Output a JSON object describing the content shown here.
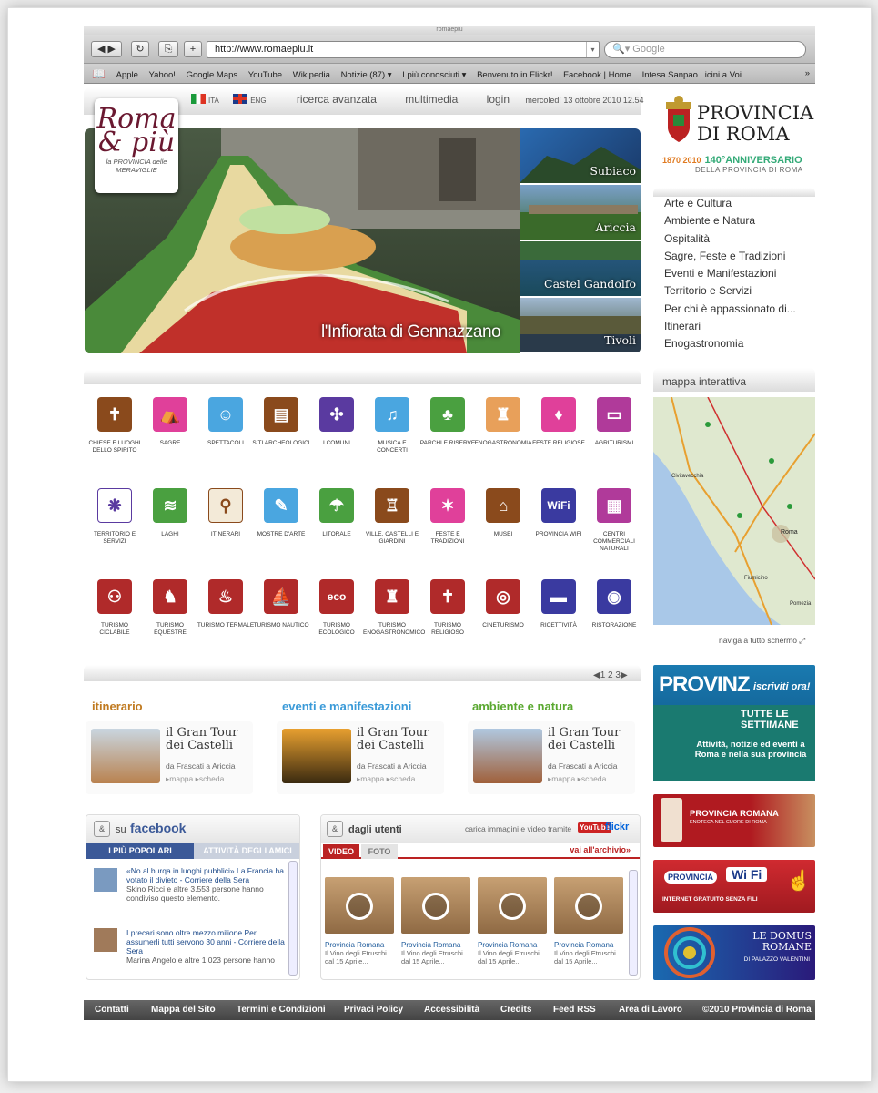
{
  "browser": {
    "window_title": "romaepiu",
    "url": "http://www.romaepiu.it",
    "search_placeholder": "Google",
    "bookmarks": [
      "Apple",
      "Yahoo!",
      "Google Maps",
      "YouTube",
      "Wikipedia",
      "Notizie (87) ▾",
      "I più conosciuti ▾",
      "Benvenuto in Flickr!",
      "Facebook | Home",
      "Intesa Sanpao...icini a Voi."
    ],
    "more": "»"
  },
  "header": {
    "lang_ita": "ITA",
    "lang_eng": "ENG",
    "nav": [
      "ricerca avanzata",
      "multimedia",
      "login"
    ],
    "date": "mercoledì 13 ottobre 2010 12.54"
  },
  "logo": {
    "title": "Roma & più",
    "subtitle": "la PROVINCIA delle MERAVIGLIE"
  },
  "hero": {
    "caption": "l'Infiorata di Gennazzano",
    "thumbs": [
      "Subiaco",
      "Ariccia",
      "Castel Gandolfo",
      "Tivoli"
    ]
  },
  "provincia": {
    "name_line1": "PROVINCIA",
    "name_line2": "DI ROMA",
    "anniversary": "140°ANNIVERSARIO",
    "anniversary_sub": "DELLA PROVINCIA DI ROMA",
    "anniversary_years": "1870 2010"
  },
  "side_menu": [
    "Arte e Cultura",
    "Ambiente e Natura",
    "Ospitalità",
    "Sagre, Feste e Tradizioni",
    "Eventi e Manifestazioni",
    "Territorio e Servizi",
    "Per chi è appassionato di...",
    "Itinerari",
    "Enogastronomia"
  ],
  "map": {
    "title": "mappa interattiva",
    "fullscreen": "naviga a tutto schermo",
    "labels": [
      "Civitavecchia",
      "Roma",
      "Fiumicino",
      "Pomezia"
    ]
  },
  "icons": [
    {
      "label": "CHIESE E LUOGHI DELLO SPIRITO",
      "color": "#8a4a1c",
      "glyph": "✝"
    },
    {
      "label": "SAGRE",
      "color": "#e0409a",
      "glyph": "⛺"
    },
    {
      "label": "SPETTACOLI",
      "color": "#4aa6e0",
      "glyph": "☺"
    },
    {
      "label": "SITI ARCHEOLOGICI",
      "color": "#8a4a1c",
      "glyph": "▤"
    },
    {
      "label": "I COMUNI",
      "color": "#5a3aa0",
      "glyph": "✣"
    },
    {
      "label": "MUSICA E CONCERTI",
      "color": "#4aa6e0",
      "glyph": "♫"
    },
    {
      "label": "PARCHI E RISERVE",
      "color": "#4aa040",
      "glyph": "♣"
    },
    {
      "label": "ENOGASTRONOMIA",
      "color": "#e8a05a",
      "glyph": "♜"
    },
    {
      "label": "FESTE RELIGIOSE",
      "color": "#e0409a",
      "glyph": "♦"
    },
    {
      "label": "AGRITURISMI",
      "color": "#b03a9a",
      "glyph": "▭"
    },
    {
      "label": "TERRITORIO E SERVIZI",
      "color": "#ffffff",
      "glyph": "❋",
      "fg": "#5a3aa0"
    },
    {
      "label": "LAGHI",
      "color": "#4aa040",
      "glyph": "≋"
    },
    {
      "label": "ITINERARI",
      "color": "#f3ead8",
      "glyph": "⚲",
      "fg": "#8a4a1c"
    },
    {
      "label": "MOSTRE D'ARTE",
      "color": "#4aa6e0",
      "glyph": "✎"
    },
    {
      "label": "LITORALE",
      "color": "#4aa040",
      "glyph": "☂"
    },
    {
      "label": "VILLE, CASTELLI E GIARDINI",
      "color": "#8a4a1c",
      "glyph": "♖"
    },
    {
      "label": "FESTE E TRADIZIONI",
      "color": "#e0409a",
      "glyph": "✶"
    },
    {
      "label": "MUSEI",
      "color": "#8a4a1c",
      "glyph": "⌂"
    },
    {
      "label": "PROVINCIA WIFI",
      "color": "#3a3aa0",
      "glyph": "WiFi"
    },
    {
      "label": "CENTRI COMMERCIALI NATURALI",
      "color": "#b03a9a",
      "glyph": "▦"
    },
    {
      "label": "TURISMO CICLABILE",
      "color": "#b02a2a",
      "glyph": "⚇"
    },
    {
      "label": "TURISMO EQUESTRE",
      "color": "#b02a2a",
      "glyph": "♞"
    },
    {
      "label": "TURISMO TERMALE",
      "color": "#b02a2a",
      "glyph": "♨"
    },
    {
      "label": "TURISMO NAUTICO",
      "color": "#b02a2a",
      "glyph": "⛵"
    },
    {
      "label": "TURISMO ECOLOGICO",
      "color": "#b02a2a",
      "glyph": "eco"
    },
    {
      "label": "TURISMO ENOGASTRONOMICO",
      "color": "#b02a2a",
      "glyph": "♜"
    },
    {
      "label": "TURISMO RELIGIOSO",
      "color": "#b02a2a",
      "glyph": "✝"
    },
    {
      "label": "CINETURISMO",
      "color": "#b02a2a",
      "glyph": "◎"
    },
    {
      "label": "RICETTIVITÀ",
      "color": "#3a3aa0",
      "glyph": "▬"
    },
    {
      "label": "RISTORAZIONE",
      "color": "#3a3aa0",
      "glyph": "◉"
    }
  ],
  "pager": {
    "prev": "◀",
    "pages": "1 2 3",
    "next": "▶"
  },
  "features": [
    {
      "section": "itinerario",
      "color": "#c07a20",
      "title": "il Gran Tour dei Castelli",
      "sub": "da Frascati a Ariccia",
      "links": "▸mappa  ▸scheda"
    },
    {
      "section": "eventi e manifestazioni",
      "color": "#3a9ad8",
      "title": "il Gran Tour dei Castelli",
      "sub": "da Frascati a Ariccia",
      "links": "▸mappa  ▸scheda"
    },
    {
      "section": "ambiente e natura",
      "color": "#5aa830",
      "title": "il Gran Tour dei Castelli",
      "sub": "da Frascati a Ariccia",
      "links": "▸mappa  ▸scheda"
    }
  ],
  "facebook": {
    "title_prefix": "su",
    "title": "facebook",
    "tab_active": "I PIÙ POPOLARI",
    "tab_other": "ATTIVITÀ DEGLI AMICI",
    "items": [
      {
        "text": "«No al burqa in luoghi pubblici» La Francia ha votato il divieto - Corriere della Sera",
        "meta": "Skino Ricci e altre 3.553 persone hanno condiviso questo elemento."
      },
      {
        "text": "I precari sono oltre mezzo milione Per assumerli tutti servono 30 anni - Corriere della Sera",
        "meta": "Marina Angelo e altre 1.023 persone hanno"
      }
    ]
  },
  "users": {
    "title": "dagli utenti",
    "upload": "carica immagini e video tramite",
    "youtube": "YouTube",
    "flickr": "flickr",
    "tab_active": "VIDEO",
    "tab_other": "FOTO",
    "archive": "vai all'archivio»",
    "videos": [
      {
        "title": "Provincia Romana",
        "desc": "Il Vino degli Etruschi dal 15 Aprile..."
      },
      {
        "title": "Provincia Romana",
        "desc": "Il Vino degli Etruschi dal 15 Aprile..."
      },
      {
        "title": "Provincia Romana",
        "desc": "Il Vino degli Etruschi dal 15 Aprile..."
      },
      {
        "title": "Provincia Romana",
        "desc": "Il Vino degli Etruschi dal 15 Aprile..."
      }
    ]
  },
  "banners": {
    "provinz_title": "PROVINZ",
    "provinz_cta": "iscriviti ora!",
    "provinz_weekly": "TUTTE LE SETTIMANE",
    "provinz_desc": "Attività, notizie ed eventi a Roma e nella sua provincia",
    "enoteca_title": "PROVINCIA ROMANA",
    "enoteca_sub": "ENOTECA NEL CUORE DI ROMA",
    "wifi_left": "PROVINCIA",
    "wifi_right": "Wi Fi",
    "wifi_sub": "INTERNET GRATUITO SENZA FILI",
    "domus_title": "LE DOMUS ROMANE",
    "domus_sub": "DI PALAZZO VALENTINI"
  },
  "footer": [
    "Contatti",
    "Mappa del Sito",
    "Termini e Condizioni",
    "Privaci Policy",
    "Accessibilità",
    "Credits",
    "Feed RSS",
    "Area di Lavoro",
    "©2010 Provincia di Roma"
  ]
}
